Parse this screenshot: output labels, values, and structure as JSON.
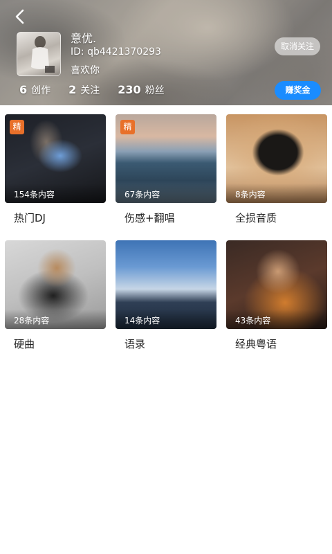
{
  "header": {
    "nickname": "意优.",
    "user_id": "ID: qb4421370293",
    "bio": "喜欢你",
    "unfollow_label": "取消关注",
    "earn_label": "赚奖金",
    "stats": [
      {
        "num": "6",
        "label": "创作"
      },
      {
        "num": "2",
        "label": "关注"
      },
      {
        "num": "230",
        "label": "粉丝"
      }
    ]
  },
  "playlists": [
    {
      "title": "热门DJ",
      "count": "154条内容",
      "badge": "精"
    },
    {
      "title": "伤感+翻唱",
      "count": "67条内容",
      "badge": "精"
    },
    {
      "title": "全损音质",
      "count": "8条内容",
      "badge": ""
    },
    {
      "title": "硬曲",
      "count": "28条内容",
      "badge": ""
    },
    {
      "title": "语录",
      "count": "14条内容",
      "badge": ""
    },
    {
      "title": "经典粤语",
      "count": "43条内容",
      "badge": ""
    }
  ],
  "colors": {
    "accent": "#1a8cff",
    "badge": "#e8702a"
  },
  "icons": {
    "back": "chevron-left-icon"
  }
}
